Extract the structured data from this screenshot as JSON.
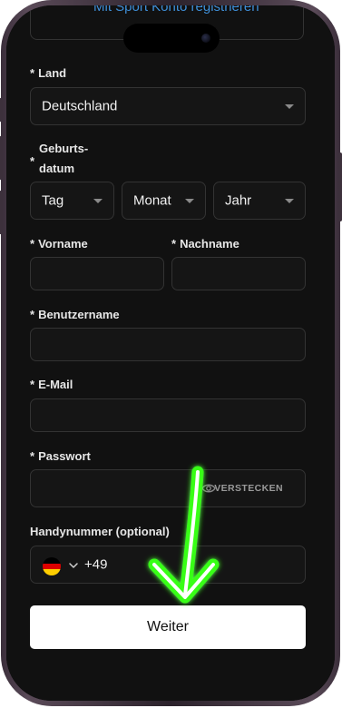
{
  "header": {
    "sport_link": "Mit Sport Konto registrieren"
  },
  "form": {
    "country": {
      "label_mark": "*",
      "label": "Land",
      "value": "Deutschland"
    },
    "birthdate": {
      "label_mark": "*",
      "label_line1": "Geburts-",
      "label_line2": "datum",
      "day": "Tag",
      "month": "Monat",
      "year": "Jahr"
    },
    "first_name": {
      "label_mark": "*",
      "label": "Vorname",
      "value": ""
    },
    "last_name": {
      "label_mark": "*",
      "label": "Nachname",
      "value": ""
    },
    "username": {
      "label_mark": "*",
      "label": "Benutzername",
      "value": ""
    },
    "email": {
      "label_mark": "*",
      "label": "E-Mail",
      "value": ""
    },
    "password": {
      "label_mark": "*",
      "label": "Passwort",
      "value": "",
      "toggle_label": "VERSTECKEN"
    },
    "phone": {
      "label": "Handynummer (optional)",
      "dial_code": "+49",
      "flag_colors": [
        "#000000",
        "#dd0000",
        "#ffce00"
      ]
    },
    "submit_label": "Weiter"
  },
  "annotation": {
    "arrow_color": "#39ff14",
    "arrow_icon": "arrow-down-icon"
  },
  "colors": {
    "background": "#111111",
    "field_border": "#333333",
    "link": "#3f8fd8",
    "button": "#ffffff"
  }
}
